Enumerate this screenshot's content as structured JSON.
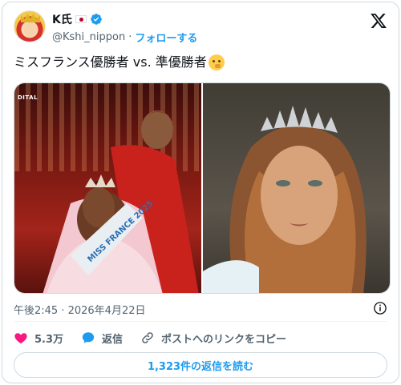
{
  "author": {
    "display_name": "K氏",
    "handle": "@Kshi_nippon",
    "separator": "·",
    "follow_label": "フォローする"
  },
  "tweet": {
    "text": "ミスフランス優勝者 vs. 準優勝者",
    "emoji": "thinking-face-emoji"
  },
  "media": {
    "left_overlay_text": "DITAL",
    "left_sash_text": "MISS FRANCE 2025"
  },
  "meta": {
    "timestamp": "午後2:45 · 2026年4月22日"
  },
  "actions": {
    "like_count": "5.3万",
    "reply_label": "返信",
    "copy_link_label": "ポストへのリンクをコピー"
  },
  "footer": {
    "read_replies_label": "1,323件の返信を読む"
  },
  "colors": {
    "accent": "#1d9bf0",
    "like": "#f91880",
    "text_secondary": "#536471",
    "border": "#cfd9de"
  }
}
